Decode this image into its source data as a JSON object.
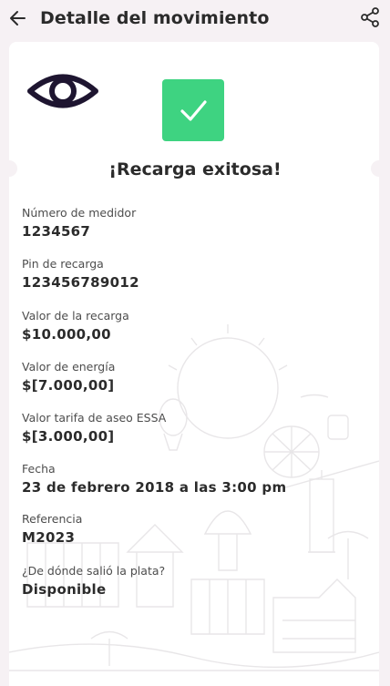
{
  "header": {
    "title": "Detalle del movimiento",
    "back_icon": "arrow-left-icon",
    "share_icon": "share-icon"
  },
  "receipt": {
    "success_icon": "check-icon",
    "success_color": "#3ed381",
    "visibility_icon": "eye-icon",
    "status": "¡Recarga exitosa!",
    "fields": [
      {
        "label": "Número de medidor",
        "value": "1234567"
      },
      {
        "label": "Pin de recarga",
        "value": "123456789012"
      },
      {
        "label": "Valor de la recarga",
        "value": "$10.000,00"
      },
      {
        "label": "Valor de energía",
        "value": "$[7.000,00]"
      },
      {
        "label": "Valor tarifa de aseo ESSA",
        "value": "$[3.000,00]"
      },
      {
        "label": "Fecha",
        "value": "23 de febrero 2018 a las 3:00 pm"
      },
      {
        "label": "Referencia",
        "value": "M2023"
      },
      {
        "label": "¿De dónde salió la plata?",
        "value": "Disponible"
      }
    ]
  }
}
